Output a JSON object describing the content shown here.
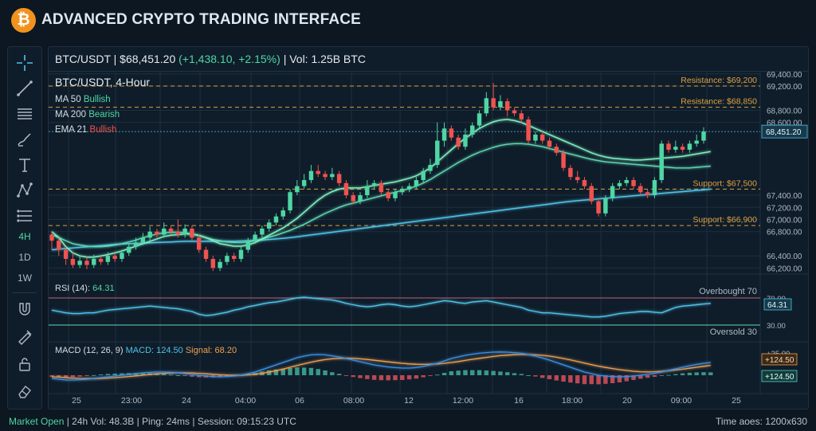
{
  "app": {
    "title": "ADVANCED CRYPTO TRADING INTERFACE",
    "logo_glyph": "₿",
    "logo_color": "#f2921e"
  },
  "toolbar": {
    "tools": [
      "crosshair-icon",
      "trend-line-icon",
      "horizontal-lines-icon",
      "brush-icon",
      "text-icon",
      "pattern-icon",
      "fib-icon"
    ],
    "timeframes": [
      {
        "label": "4H",
        "active": true
      },
      {
        "label": "1D",
        "active": false
      },
      {
        "label": "1W",
        "active": false
      }
    ],
    "bottom_tools": [
      "magnet-icon",
      "measure-icon",
      "lock-icon",
      "eraser-icon"
    ]
  },
  "ticker": {
    "pair": "BTC/USDT",
    "price": "$68,451.20",
    "change": "(+1,438.10, +2.15%)",
    "volume": "Vol: 1.25B BTC",
    "separator": "|"
  },
  "legend": {
    "title": "BTC/USDT, 4-Hour",
    "items": [
      {
        "name": "MA 50",
        "status": "Bullish",
        "color": "#4fd6a4"
      },
      {
        "name": "MA 200",
        "status": "Bearish",
        "color": "#4fd6a4"
      },
      {
        "name": "EMA 21",
        "status": "Bullish",
        "color": "#ef5350"
      }
    ]
  },
  "colors": {
    "up": "#26a69a",
    "up_bright": "#4fd6a4",
    "down": "#ef5350",
    "ma_light": "#7ef0c0",
    "ma_blue": "#4fc3e8",
    "resistance": "#e0a040",
    "rsi": "#4fc3e8",
    "macd": "#3d8fe0",
    "signal": "#f0a050"
  },
  "levels": [
    {
      "label": "Resistance: $69,200",
      "value": 69200
    },
    {
      "label": "Resistance: $68,850",
      "value": 68850
    },
    {
      "label": "Support: $67,500",
      "value": 67500
    },
    {
      "label": "Support: $66,900",
      "value": 66900
    }
  ],
  "rsi": {
    "label": "RSI (14):",
    "value": "64.31",
    "overbought_label": "Overbought 70",
    "oversold_label": "Oversold 30",
    "axis": [
      "70.00",
      "30.00"
    ],
    "tag": "64.31"
  },
  "macd": {
    "label": "MACD (12, 26, 9)",
    "macd_value": "MACD: 124.50",
    "signal_value": "Signal: 68.20",
    "tag_orange": "+124.50",
    "tag_teal": "+124.50",
    "axis_top": "+25.00"
  },
  "chart_data": {
    "type": "candlestick",
    "title": "BTC/USDT, 4-Hour",
    "ylim": [
      66100,
      69450
    ],
    "y_ticks": [
      "69,400.00",
      "69,200.00",
      "68,800.00",
      "68,600.00",
      "67,400.00",
      "67,200.00",
      "67,000.00",
      "66,800.00",
      "66,400.00",
      "66,200.00"
    ],
    "y_tick_values": [
      69400,
      69200,
      68800,
      68600,
      67400,
      67200,
      67000,
      66800,
      66400,
      66200
    ],
    "x_ticks": [
      "25",
      "23:00",
      "24",
      "04:00",
      "06",
      "08:00",
      "12",
      "12:00",
      "16",
      "18:00",
      "20",
      "09:00",
      "25"
    ],
    "last_price": "68,451.20",
    "candles": [
      [
        66750,
        66650,
        66800,
        66500
      ],
      [
        66650,
        66500,
        66700,
        66400
      ],
      [
        66500,
        66350,
        66550,
        66250
      ],
      [
        66350,
        66250,
        66450,
        66200
      ],
      [
        66250,
        66320,
        66400,
        66200
      ],
      [
        66320,
        66250,
        66380,
        66180
      ],
      [
        66250,
        66350,
        66420,
        66200
      ],
      [
        66350,
        66300,
        66400,
        66250
      ],
      [
        66300,
        66400,
        66460,
        66250
      ],
      [
        66400,
        66350,
        66450,
        66300
      ],
      [
        66350,
        66450,
        66500,
        66300
      ],
      [
        66450,
        66550,
        66600,
        66400
      ],
      [
        66550,
        66620,
        66700,
        66500
      ],
      [
        66620,
        66700,
        66780,
        66580
      ],
      [
        66700,
        66800,
        66880,
        66650
      ],
      [
        66800,
        66750,
        66850,
        66700
      ],
      [
        66750,
        66850,
        66950,
        66700
      ],
      [
        66850,
        66800,
        66900,
        66750
      ],
      [
        66800,
        66750,
        67000,
        66700
      ],
      [
        66750,
        66850,
        66920,
        66700
      ],
      [
        66850,
        66700,
        66900,
        66650
      ],
      [
        66700,
        66500,
        66750,
        66450
      ],
      [
        66500,
        66350,
        66550,
        66300
      ],
      [
        66350,
        66200,
        66400,
        66150
      ],
      [
        66200,
        66300,
        66350,
        66150
      ],
      [
        66300,
        66400,
        66450,
        66250
      ],
      [
        66400,
        66350,
        66450,
        66300
      ],
      [
        66350,
        66500,
        66550,
        66300
      ],
      [
        66500,
        66650,
        66700,
        66450
      ],
      [
        66650,
        66750,
        66800,
        66600
      ],
      [
        66750,
        66850,
        66900,
        66700
      ],
      [
        66850,
        66950,
        67000,
        66800
      ],
      [
        66950,
        67050,
        67100,
        66900
      ],
      [
        67050,
        67150,
        67200,
        67000
      ],
      [
        67150,
        67450,
        67500,
        67100
      ],
      [
        67450,
        67550,
        67650,
        67400
      ],
      [
        67550,
        67650,
        67750,
        67500
      ],
      [
        67650,
        67800,
        67900,
        67600
      ],
      [
        67800,
        67750,
        67900,
        67700
      ],
      [
        67750,
        67700,
        67800,
        67650
      ],
      [
        67700,
        67750,
        67850,
        67650
      ],
      [
        67750,
        67600,
        67800,
        67550
      ],
      [
        67600,
        67400,
        67650,
        67350
      ],
      [
        67400,
        67300,
        67450,
        67250
      ],
      [
        67300,
        67400,
        67450,
        67250
      ],
      [
        67400,
        67550,
        67650,
        67350
      ],
      [
        67550,
        67600,
        67650,
        67500
      ],
      [
        67600,
        67450,
        67650,
        67400
      ],
      [
        67450,
        67350,
        67500,
        67300
      ],
      [
        67350,
        67450,
        67500,
        67300
      ],
      [
        67450,
        67500,
        67550,
        67400
      ],
      [
        67500,
        67550,
        67600,
        67450
      ],
      [
        67550,
        67650,
        67700,
        67500
      ],
      [
        67650,
        67800,
        67850,
        67600
      ],
      [
        67800,
        67900,
        68000,
        67750
      ],
      [
        67900,
        68300,
        68600,
        67850
      ],
      [
        68300,
        68500,
        68600,
        68200
      ],
      [
        68500,
        68350,
        68550,
        68300
      ],
      [
        68350,
        68200,
        68400,
        68150
      ],
      [
        68200,
        68400,
        68500,
        68150
      ],
      [
        68400,
        68550,
        68600,
        68350
      ],
      [
        68550,
        68750,
        68800,
        68500
      ],
      [
        68750,
        69000,
        69100,
        68700
      ],
      [
        69000,
        68850,
        69250,
        68800
      ],
      [
        68850,
        68950,
        69050,
        68800
      ],
      [
        68950,
        68800,
        69000,
        68700
      ],
      [
        68800,
        68750,
        68850,
        68700
      ],
      [
        68750,
        68650,
        68800,
        68600
      ],
      [
        68650,
        68300,
        68700,
        68250
      ],
      [
        68300,
        68400,
        68450,
        68250
      ],
      [
        68400,
        68300,
        68450,
        68250
      ],
      [
        68300,
        68200,
        68350,
        68150
      ],
      [
        68200,
        68100,
        68250,
        68050
      ],
      [
        68100,
        67850,
        68150,
        67800
      ],
      [
        67850,
        67700,
        67900,
        67650
      ],
      [
        67700,
        67650,
        67800,
        67600
      ],
      [
        67650,
        67550,
        67700,
        67500
      ],
      [
        67550,
        67300,
        67600,
        67250
      ],
      [
        67300,
        67100,
        67350,
        67050
      ],
      [
        67100,
        67350,
        67400,
        67050
      ],
      [
        67350,
        67550,
        67600,
        67300
      ],
      [
        67550,
        67600,
        67650,
        67500
      ],
      [
        67600,
        67650,
        67700,
        67550
      ],
      [
        67650,
        67550,
        67700,
        67500
      ],
      [
        67550,
        67450,
        67600,
        67400
      ],
      [
        67450,
        67400,
        67500,
        67350
      ],
      [
        67400,
        67650,
        67700,
        67350
      ],
      [
        67650,
        68250,
        68300,
        67600
      ],
      [
        68250,
        68150,
        68300,
        68100
      ],
      [
        68150,
        68200,
        68300,
        68100
      ],
      [
        68200,
        68150,
        68250,
        68100
      ],
      [
        68150,
        68250,
        68300,
        68100
      ],
      [
        68250,
        68300,
        68400,
        68200
      ],
      [
        68300,
        68450,
        68520,
        68250
      ]
    ],
    "ma_light": [
      66800,
      66700,
      66550,
      66450,
      66400,
      66380,
      66380,
      66400,
      66420,
      66450,
      66480,
      66520,
      66560,
      66600,
      66640,
      66680,
      66720,
      66740,
      66750,
      66760,
      66760,
      66740,
      66700,
      66650,
      66600,
      66580,
      66560,
      66560,
      66580,
      66620,
      66680,
      66740,
      66800,
      66860,
      66940,
      67020,
      67120,
      67220,
      67320,
      67400,
      67460,
      67500,
      67520,
      67520,
      67520,
      67540,
      67560,
      67580,
      67600,
      67620,
      67650,
      67680,
      67720,
      67780,
      67850,
      67950,
      68050,
      68150,
      68250,
      68340,
      68420,
      68500,
      68560,
      68610,
      68640,
      68650,
      68630,
      68600,
      68550,
      68500,
      68450,
      68400,
      68350,
      68300,
      68250,
      68200,
      68150,
      68100,
      68060,
      68030,
      68010,
      68000,
      67990,
      67980,
      67980,
      67990,
      68000,
      68010,
      68020,
      68030,
      68040,
      68060,
      68080,
      68100,
      68120
    ],
    "ma_teal": [
      66750,
      66700,
      66650,
      66600,
      66580,
      66560,
      66550,
      66550,
      66560,
      66580,
      66600,
      66630,
      66660,
      66700,
      66730,
      66760,
      66780,
      66790,
      66790,
      66780,
      66760,
      66730,
      66700,
      66670,
      66650,
      66630,
      66620,
      66620,
      66630,
      66650,
      66680,
      66710,
      66740,
      66780,
      66820,
      66870,
      66920,
      66980,
      67040,
      67100,
      67150,
      67200,
      67240,
      67270,
      67300,
      67330,
      67360,
      67390,
      67420,
      67450,
      67480,
      67510,
      67550,
      67600,
      67660,
      67730,
      67800,
      67870,
      67940,
      68000,
      68060,
      68110,
      68150,
      68190,
      68220,
      68240,
      68250,
      68250,
      68240,
      68220,
      68200,
      68170,
      68140,
      68110,
      68080,
      68050,
      68020,
      67990,
      67970,
      67950,
      67940,
      67930,
      67920,
      67910,
      67900,
      67890,
      67880,
      67870,
      67860,
      67850,
      67850,
      67850,
      67860,
      67870,
      67880
    ],
    "ma_blue": [
      66500,
      66510,
      66520,
      66530,
      66540,
      66550,
      66560,
      66570,
      66580,
      66590,
      66595,
      66600,
      66605,
      66610,
      66615,
      66620,
      66625,
      66630,
      66635,
      66640,
      66640,
      66640,
      66640,
      66640,
      66640,
      66640,
      66640,
      66645,
      66650,
      66655,
      66660,
      66670,
      66680,
      66690,
      66700,
      66715,
      66730,
      66745,
      66760,
      66775,
      66790,
      66805,
      66820,
      66835,
      66850,
      66865,
      66880,
      66895,
      66910,
      66925,
      66940,
      66955,
      66970,
      66985,
      67000,
      67015,
      67030,
      67045,
      67060,
      67075,
      67090,
      67105,
      67120,
      67135,
      67150,
      67165,
      67180,
      67195,
      67210,
      67225,
      67240,
      67255,
      67270,
      67285,
      67300,
      67310,
      67320,
      67330,
      67340,
      67350,
      67360,
      67370,
      67380,
      67390,
      67400,
      67410,
      67420,
      67430,
      67440,
      67450,
      67460,
      67470,
      67480,
      67490,
      67500
    ],
    "rsi_values": [
      52,
      50,
      48,
      47,
      47,
      48,
      48,
      50,
      52,
      53,
      54,
      55,
      56,
      57,
      58,
      57,
      56,
      55,
      54,
      52,
      50,
      46,
      44,
      45,
      47,
      49,
      52,
      54,
      57,
      59,
      61,
      63,
      64,
      66,
      68,
      70,
      71,
      70,
      69,
      68,
      67,
      65,
      62,
      60,
      58,
      57,
      58,
      60,
      61,
      60,
      58,
      57,
      58,
      60,
      62,
      64,
      66,
      65,
      63,
      62,
      64,
      65,
      66,
      64,
      62,
      60,
      58,
      56,
      52,
      50,
      48,
      48,
      47,
      46,
      45,
      44,
      43,
      42,
      42,
      43,
      45,
      47,
      48,
      49,
      50,
      50,
      49,
      48,
      52,
      56,
      58,
      59,
      60,
      61,
      62
    ],
    "macd_values": [
      -20,
      -25,
      -30,
      -30,
      -28,
      -25,
      -20,
      -15,
      -10,
      -5,
      0,
      5,
      10,
      15,
      18,
      20,
      20,
      18,
      15,
      10,
      5,
      0,
      -5,
      -8,
      -10,
      -8,
      -5,
      0,
      10,
      20,
      35,
      50,
      65,
      80,
      95,
      110,
      120,
      128,
      130,
      128,
      122,
      115,
      105,
      95,
      85,
      75,
      65,
      58,
      52,
      48,
      45,
      45,
      48,
      55,
      65,
      75,
      90,
      105,
      115,
      125,
      132,
      138,
      142,
      145,
      146,
      145,
      142,
      138,
      130,
      120,
      108,
      95,
      80,
      65,
      50,
      35,
      20,
      10,
      0,
      -5,
      -8,
      -10,
      -8,
      -5,
      0,
      5,
      12,
      20,
      30,
      40,
      50,
      60,
      68,
      75,
      80
    ],
    "signal_values": [
      -10,
      -12,
      -15,
      -18,
      -20,
      -21,
      -21,
      -20,
      -18,
      -15,
      -12,
      -8,
      -4,
      0,
      5,
      9,
      12,
      14,
      15,
      15,
      14,
      12,
      9,
      6,
      3,
      1,
      0,
      0,
      2,
      6,
      12,
      20,
      29,
      39,
      50,
      61,
      72,
      82,
      91,
      98,
      103,
      106,
      107,
      106,
      103,
      99,
      94,
      89,
      84,
      79,
      75,
      71,
      69,
      68,
      69,
      71,
      75,
      80,
      86,
      93,
      100,
      106,
      112,
      118,
      123,
      126,
      129,
      130,
      130,
      128,
      125,
      120,
      113,
      105,
      96,
      86,
      76,
      66,
      57,
      49,
      42,
      35,
      30,
      25,
      22,
      21,
      22,
      24,
      28,
      33,
      38,
      44,
      50,
      56,
      62
    ]
  },
  "status": {
    "market": "Market Open",
    "info": "| 24h Vol: 48.3B | Ping: 24ms | Session: 09:15:23 UTC",
    "right": "Time aoes: 1200x630"
  }
}
